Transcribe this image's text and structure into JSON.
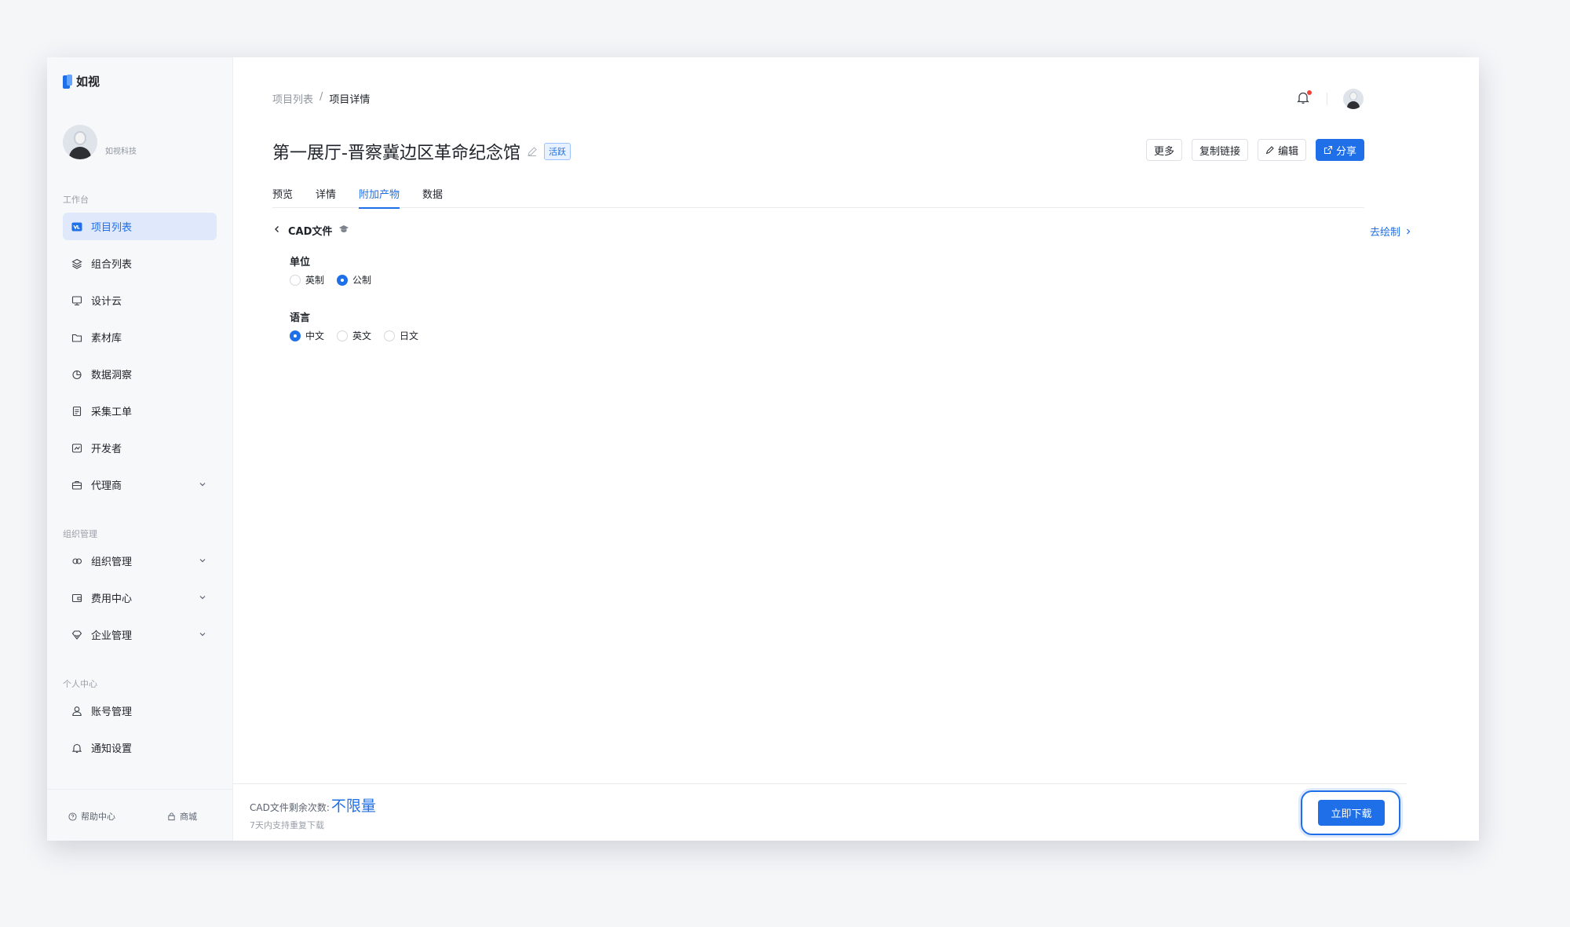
{
  "app": {
    "brand": "如视",
    "org_name": "如视科技"
  },
  "sidebar": {
    "sections": [
      {
        "title": "工作台"
      },
      {
        "title": "组织管理"
      },
      {
        "title": "个人中心"
      }
    ],
    "items": [
      {
        "label": "项目列表",
        "icon": "project-list-icon",
        "active": true
      },
      {
        "label": "组合列表",
        "icon": "layers-icon"
      },
      {
        "label": "设计云",
        "icon": "monitor-icon"
      },
      {
        "label": "素材库",
        "icon": "folder-icon"
      },
      {
        "label": "数据洞察",
        "icon": "pie-chart-icon"
      },
      {
        "label": "采集工单",
        "icon": "document-icon"
      },
      {
        "label": "开发者",
        "icon": "code-icon"
      },
      {
        "label": "代理商",
        "icon": "briefcase-icon",
        "expandable": true
      },
      {
        "label": "组织管理",
        "icon": "org-icon",
        "expandable": true
      },
      {
        "label": "费用中心",
        "icon": "wallet-icon",
        "expandable": true
      },
      {
        "label": "企业管理",
        "icon": "diamond-icon",
        "expandable": true
      },
      {
        "label": "账号管理",
        "icon": "user-icon"
      },
      {
        "label": "通知设置",
        "icon": "bell-icon"
      }
    ],
    "footer": {
      "help": "帮助中心",
      "shop": "商城"
    }
  },
  "breadcrumb": {
    "parent": "项目列表",
    "separator": "/",
    "current": "项目详情"
  },
  "header": {
    "title": "第一展厅-晋察冀边区革命纪念馆",
    "status": "活跃",
    "actions": {
      "more": "更多",
      "copy_link": "复制链接",
      "edit": "编辑",
      "share": "分享"
    }
  },
  "tabs": [
    {
      "label": "预览"
    },
    {
      "label": "详情"
    },
    {
      "label": "附加产物",
      "active": true
    },
    {
      "label": "数据"
    }
  ],
  "cad": {
    "title": "CAD文件",
    "draw_link": "去绘制",
    "unit": {
      "label": "单位",
      "options": [
        "英制",
        "公制"
      ],
      "selected": "公制"
    },
    "language": {
      "label": "语言",
      "options": [
        "中文",
        "英文",
        "日文"
      ],
      "selected": "中文"
    }
  },
  "footer_bar": {
    "quota_label": "CAD文件剩余次数:",
    "quota_value": "不限量",
    "hint": "7天内支持重复下载",
    "download": "立即下载"
  },
  "colors": {
    "accent": "#1f6fe8",
    "active_bg": "#dfe9fb",
    "alert": "#f04438"
  }
}
